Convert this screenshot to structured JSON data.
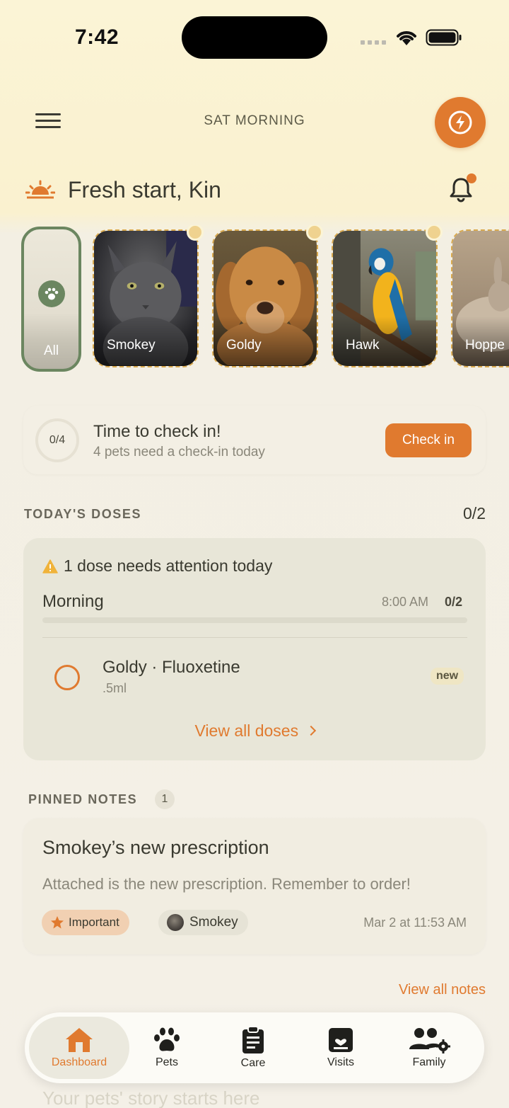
{
  "status_bar": {
    "time": "7:42"
  },
  "header": {
    "title": "SAT MORNING",
    "greeting": "Fresh start, Kin"
  },
  "pets": {
    "all_label": "All",
    "items": [
      {
        "name": "Smokey"
      },
      {
        "name": "Goldy"
      },
      {
        "name": "Hawk"
      },
      {
        "name": "Hoppe"
      }
    ]
  },
  "checkin": {
    "progress": "0/4",
    "title": "Time to check in!",
    "subtitle": "4 pets need a check-in today",
    "button": "Check in"
  },
  "doses": {
    "section_label": "TODAY'S DOSES",
    "count": "0/2",
    "attention": "1 dose needs attention today",
    "group": "Morning",
    "group_time": "8:00 AM",
    "group_count": "0/2",
    "group_progress": 0,
    "item_name": "Goldy · Fluoxetine",
    "item_amount": ".5ml",
    "item_badge": "new",
    "view_all": "View all doses"
  },
  "notes": {
    "section_label": "PINNED NOTES",
    "count": "1",
    "title": "Smokey’s new prescription",
    "body": "Attached is the new prescription. Remember to order!",
    "tag": "Important",
    "pet": "Smokey",
    "time": "Mar 2 at 11:53 AM",
    "view_all": "View all notes"
  },
  "ghost_text": "Your pets' story starts here",
  "tabbar": {
    "tabs": [
      {
        "label": "Dashboard",
        "icon": "house-icon"
      },
      {
        "label": "Pets",
        "icon": "paw-icon"
      },
      {
        "label": "Care",
        "icon": "clipboard-icon"
      },
      {
        "label": "Visits",
        "icon": "calendar-heart-icon"
      },
      {
        "label": "Family",
        "icon": "family-gear-icon"
      }
    ],
    "active": "Dashboard"
  },
  "colors": {
    "accent": "#e07a2f",
    "green": "#6b8660",
    "text": "#3a3a30",
    "muted": "#8a877a"
  }
}
